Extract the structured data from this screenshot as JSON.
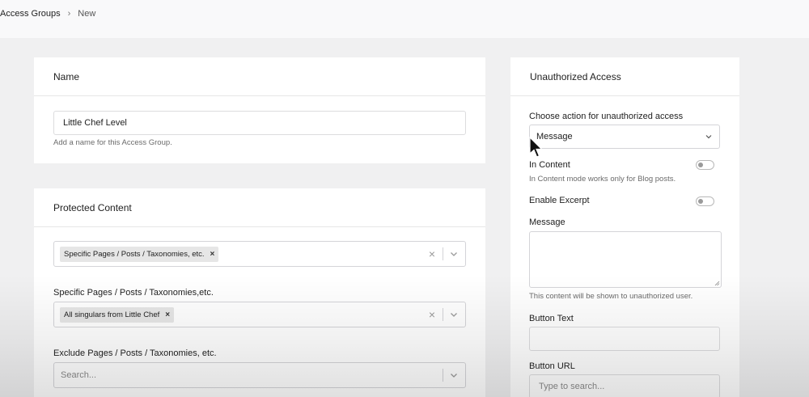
{
  "breadcrumb": {
    "parent": "Access Groups",
    "separator": "›",
    "current": "New"
  },
  "name_card": {
    "title": "Name",
    "input_value": "Little Chef Level",
    "help": "Add a name for this Access Group."
  },
  "protected_card": {
    "title": "Protected Content",
    "content_type_tag": "Specific Pages / Posts / Taxonomies, etc.",
    "specific_label": "Specific Pages / Posts / Taxonomies,etc.",
    "specific_tag": "All singulars from Little Chef",
    "exclude_label": "Exclude Pages / Posts / Taxonomies, etc.",
    "exclude_placeholder": "Search..."
  },
  "unauth_card": {
    "title": "Unauthorized Access",
    "action_label": "Choose action for unauthorized access",
    "action_value": "Message",
    "in_content_label": "In Content",
    "in_content_help": "In Content mode works only for Blog posts.",
    "excerpt_label": "Enable Excerpt",
    "message_label": "Message",
    "message_help": "This content will be shown to unauthorized user.",
    "button_text_label": "Button Text",
    "button_url_label": "Button URL",
    "button_url_placeholder": "Type to search..."
  },
  "icons": {
    "clear": "×",
    "chevron": "chevron-down-icon",
    "tag_remove": "×"
  }
}
